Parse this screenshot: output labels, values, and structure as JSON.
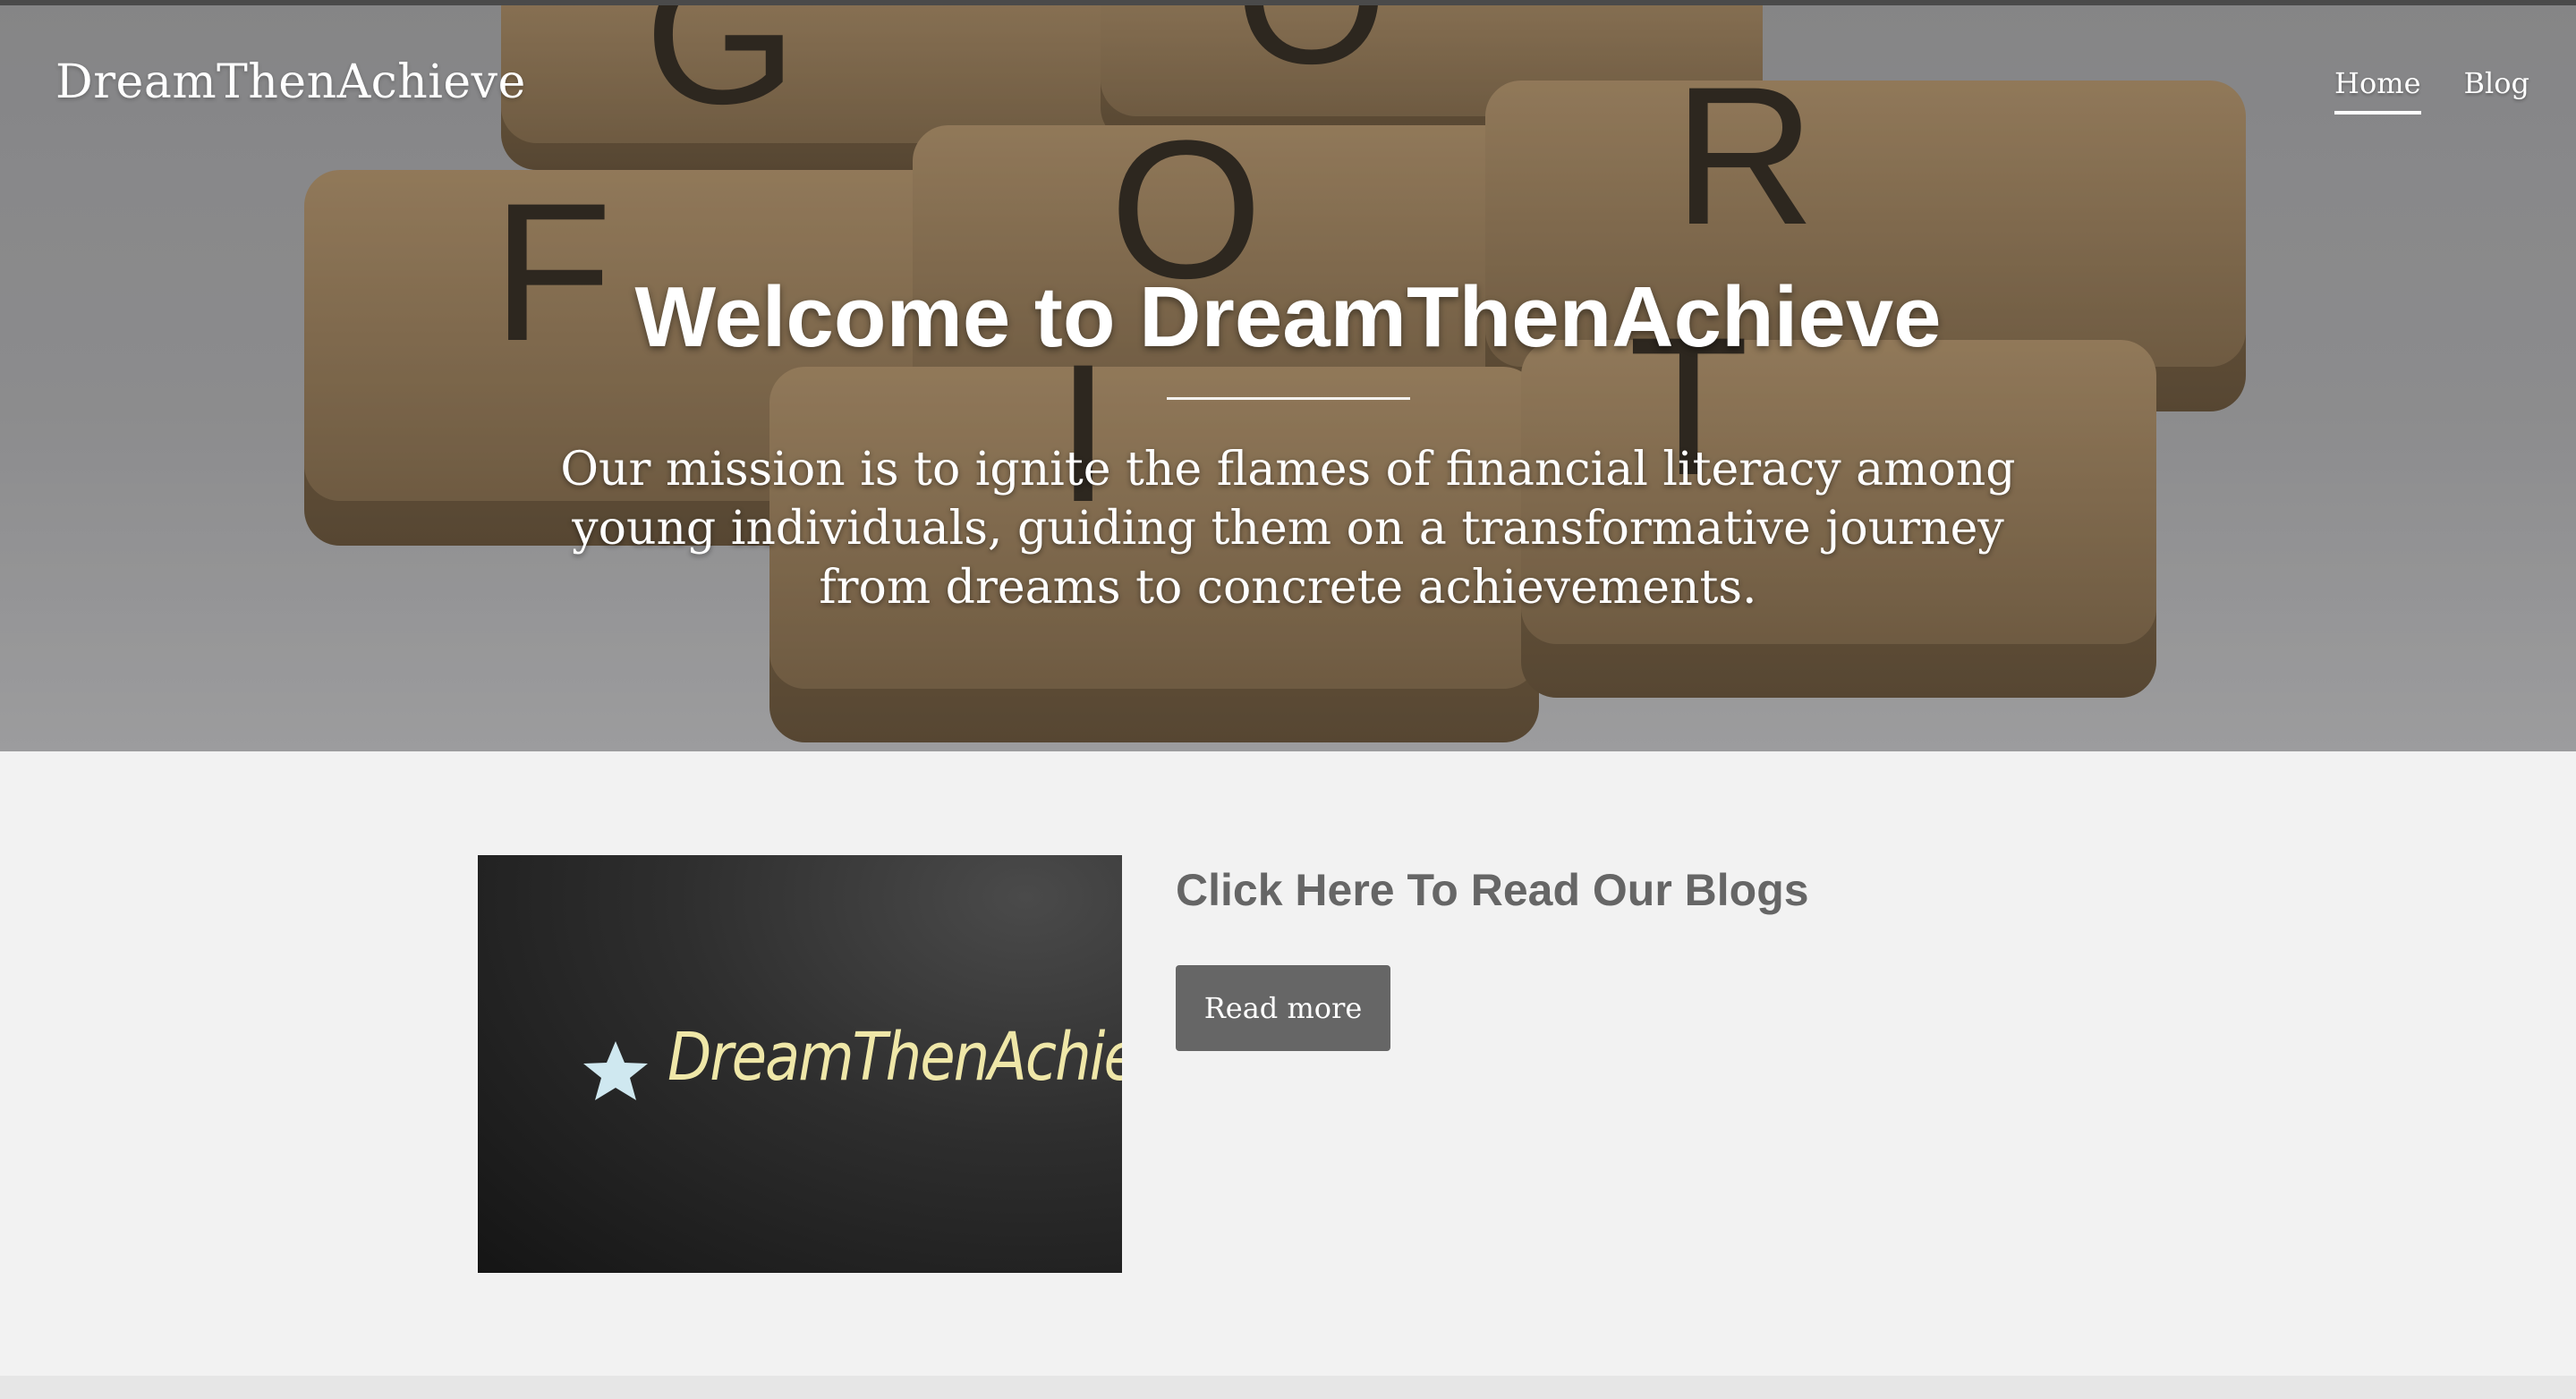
{
  "site": {
    "brand": "DreamThenAchieve"
  },
  "nav": {
    "items": [
      {
        "label": "Home",
        "active": true
      },
      {
        "label": "Blog",
        "active": false
      }
    ]
  },
  "hero": {
    "title": "Welcome to DreamThenAchieve",
    "subtitle": "Our mission is to ignite the flames of financial literacy among young individuals, guiding them on a transformative journey from dreams to concrete achievements.",
    "tile_letters": [
      "G",
      "O",
      "F",
      "O",
      "R",
      "I",
      "T"
    ]
  },
  "feature": {
    "image_logo_text": "DreamThenAchieve",
    "title": "Click Here To Read Our Blogs",
    "button_label": "Read more"
  },
  "colors": {
    "button_bg": "#666666",
    "title_text": "#666666",
    "page_bg": "#f2f2f2",
    "logo_text": "#efe7a8",
    "star": "#cfe8f0"
  }
}
